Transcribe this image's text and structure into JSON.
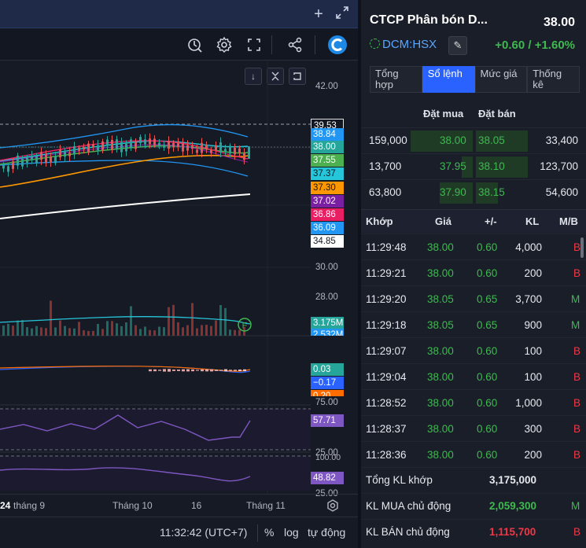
{
  "chart": {
    "axis_ticks": [
      "42.00",
      "30.00",
      "28.00",
      "75.00",
      "25.00",
      "100.00",
      "25.00"
    ],
    "price_labels": [
      {
        "text": "39.53",
        "bg": "#131722",
        "fg": "#ffffff",
        "border": "#e0e0e0"
      },
      {
        "text": "38.84",
        "bg": "#2196f3",
        "fg": "#ffffff"
      },
      {
        "text": "38.00",
        "bg": "#26a69a",
        "fg": "#ffffff"
      },
      {
        "text": "37.55",
        "bg": "#4caf50",
        "fg": "#ffffff"
      },
      {
        "text": "37.37",
        "bg": "#26c6da",
        "fg": "#131722"
      },
      {
        "text": "37.30",
        "bg": "#ff9800",
        "fg": "#131722"
      },
      {
        "text": "37.02",
        "bg": "#7b1fa2",
        "fg": "#ffffff"
      },
      {
        "text": "36.86",
        "bg": "#e91e63",
        "fg": "#ffffff"
      },
      {
        "text": "36.09",
        "bg": "#2196f3",
        "fg": "#ffffff"
      },
      {
        "text": "34.85",
        "bg": "#ffffff",
        "fg": "#131722"
      }
    ],
    "volume_labels": [
      {
        "text": "3.175M",
        "bg": "#26a69a"
      },
      {
        "text": "2.532M",
        "bg": "#2196f3"
      }
    ],
    "macd_labels": [
      {
        "text": "0.03",
        "bg": "#26a69a"
      },
      {
        "text": "−0.17",
        "bg": "#2962ff"
      },
      {
        "text": "0.20",
        "bg": "#ff6d00"
      }
    ],
    "rsi_label": "57.71",
    "stoch_label": "48.82",
    "volume_badge": "F",
    "xaxis": [
      "24",
      "tháng 9",
      "Tháng 10",
      "16",
      "Tháng 11"
    ],
    "status": {
      "time": "11:32:42 (UTC+7)",
      "percent": "%",
      "log": "log",
      "auto": "tự động"
    }
  },
  "stock": {
    "name": "CTCP Phân bón D...",
    "price": "38.00",
    "ticker": "DCM:HSX",
    "change": "+0.60 / +1.60%"
  },
  "tabs": [
    {
      "label": "Tổng hợp",
      "active": false
    },
    {
      "label": "Sổ lệnh",
      "active": true
    },
    {
      "label": "Mức giá",
      "active": false
    },
    {
      "label": "Thống kê",
      "active": false
    }
  ],
  "orderbook": {
    "headers": {
      "bid": "Đặt mua",
      "ask": "Đặt bán"
    },
    "rows": [
      {
        "bid_vol": "159,000",
        "bid": "38.00",
        "ask": "38.05",
        "ask_vol": "33,400"
      },
      {
        "bid_vol": "13,700",
        "bid": "37.95",
        "ask": "38.10",
        "ask_vol": "123,700"
      },
      {
        "bid_vol": "63,800",
        "bid": "37.90",
        "ask": "38.15",
        "ask_vol": "54,600"
      }
    ]
  },
  "trades": {
    "headers": {
      "time": "Khớp",
      "price": "Giá",
      "change": "+/-",
      "vol": "KL",
      "side": "M/B"
    },
    "rows": [
      {
        "time": "11:29:48",
        "price": "38.00",
        "change": "0.60",
        "vol": "4,000",
        "side": "B"
      },
      {
        "time": "11:29:21",
        "price": "38.00",
        "change": "0.60",
        "vol": "200",
        "side": "B"
      },
      {
        "time": "11:29:20",
        "price": "38.05",
        "change": "0.65",
        "vol": "3,700",
        "side": "M"
      },
      {
        "time": "11:29:18",
        "price": "38.05",
        "change": "0.65",
        "vol": "900",
        "side": "M"
      },
      {
        "time": "11:29:07",
        "price": "38.00",
        "change": "0.60",
        "vol": "100",
        "side": "B"
      },
      {
        "time": "11:29:04",
        "price": "38.00",
        "change": "0.60",
        "vol": "100",
        "side": "B"
      },
      {
        "time": "11:28:52",
        "price": "38.00",
        "change": "0.60",
        "vol": "1,000",
        "side": "B"
      },
      {
        "time": "11:28:37",
        "price": "38.00",
        "change": "0.60",
        "vol": "300",
        "side": "B"
      },
      {
        "time": "11:28:36",
        "price": "38.00",
        "change": "0.60",
        "vol": "200",
        "side": "B"
      }
    ]
  },
  "summary": [
    {
      "label": "Tổng KL khớp",
      "value": "3,175,000",
      "side": ""
    },
    {
      "label": "KL MUA chủ động",
      "value": "2,059,300",
      "side": "M"
    },
    {
      "label": "KL BÁN chủ động",
      "value": "1,115,700",
      "side": "B"
    }
  ]
}
